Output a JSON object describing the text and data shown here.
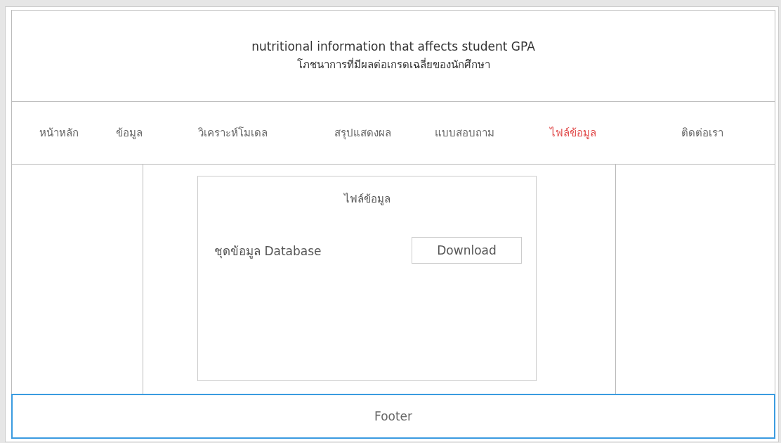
{
  "header": {
    "title": "nutritional information that affects student GPA",
    "subtitle": "โภชนาการที่มีผลต่อเกรดเฉลี่ยของนักศึกษา"
  },
  "nav": [
    {
      "label": "หน้าหลัก",
      "selected": false
    },
    {
      "label": "ข้อมูล",
      "selected": false
    },
    {
      "label": "วิเคราะห์โมเดล",
      "selected": false
    },
    {
      "label": "สรุปแสดงผล",
      "selected": false
    },
    {
      "label": "แบบสอบถาม",
      "selected": false
    },
    {
      "label": "ไฟล์ข้อมูล",
      "selected": true
    },
    {
      "label": "ติดต่อเรา",
      "selected": false
    }
  ],
  "card": {
    "title": "ไฟล์ข้อมูล",
    "item_label": "ชุดข้อมูล Database",
    "button": "Download"
  },
  "footer": "Footer"
}
